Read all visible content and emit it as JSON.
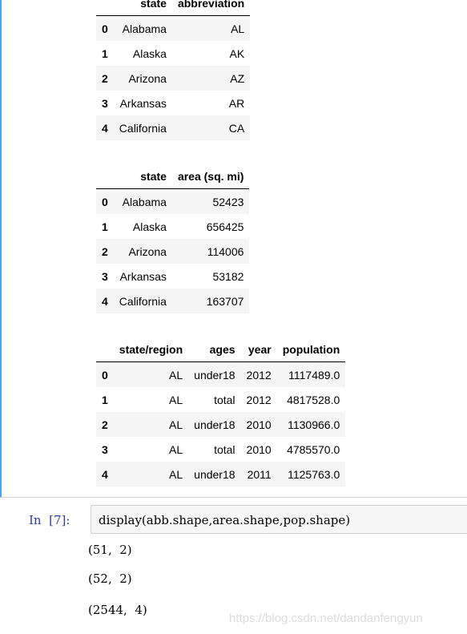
{
  "tables": [
    {
      "columns": [
        "",
        "state",
        "abbreviation"
      ],
      "rows": [
        [
          "0",
          "Alabama",
          "AL"
        ],
        [
          "1",
          "Alaska",
          "AK"
        ],
        [
          "2",
          "Arizona",
          "AZ"
        ],
        [
          "3",
          "Arkansas",
          "AR"
        ],
        [
          "4",
          "California",
          "CA"
        ]
      ]
    },
    {
      "columns": [
        "",
        "state",
        "area (sq. mi)"
      ],
      "rows": [
        [
          "0",
          "Alabama",
          "52423"
        ],
        [
          "1",
          "Alaska",
          "656425"
        ],
        [
          "2",
          "Arizona",
          "114006"
        ],
        [
          "3",
          "Arkansas",
          "53182"
        ],
        [
          "4",
          "California",
          "163707"
        ]
      ]
    },
    {
      "columns": [
        "",
        "state/region",
        "ages",
        "year",
        "population"
      ],
      "rows": [
        [
          "0",
          "AL",
          "under18",
          "2012",
          "1117489.0"
        ],
        [
          "1",
          "AL",
          "total",
          "2012",
          "4817528.0"
        ],
        [
          "2",
          "AL",
          "under18",
          "2010",
          "1130966.0"
        ],
        [
          "3",
          "AL",
          "total",
          "2010",
          "4785570.0"
        ],
        [
          "4",
          "AL",
          "under18",
          "2011",
          "1125763.0"
        ]
      ]
    }
  ],
  "cell": {
    "prompt": "In  [7]:",
    "code": "display(abb.shape,area.shape,pop.shape)",
    "outputs": [
      "(51,  2)",
      "(52,  2)",
      "(2544,  4)"
    ]
  },
  "watermark": "https://blog.csdn.net/dandanfengyun",
  "colors": {
    "selected_cell_bar": "#42a5f5",
    "prompt": "#303f9f",
    "row_stripe": "#f5f5f5"
  }
}
